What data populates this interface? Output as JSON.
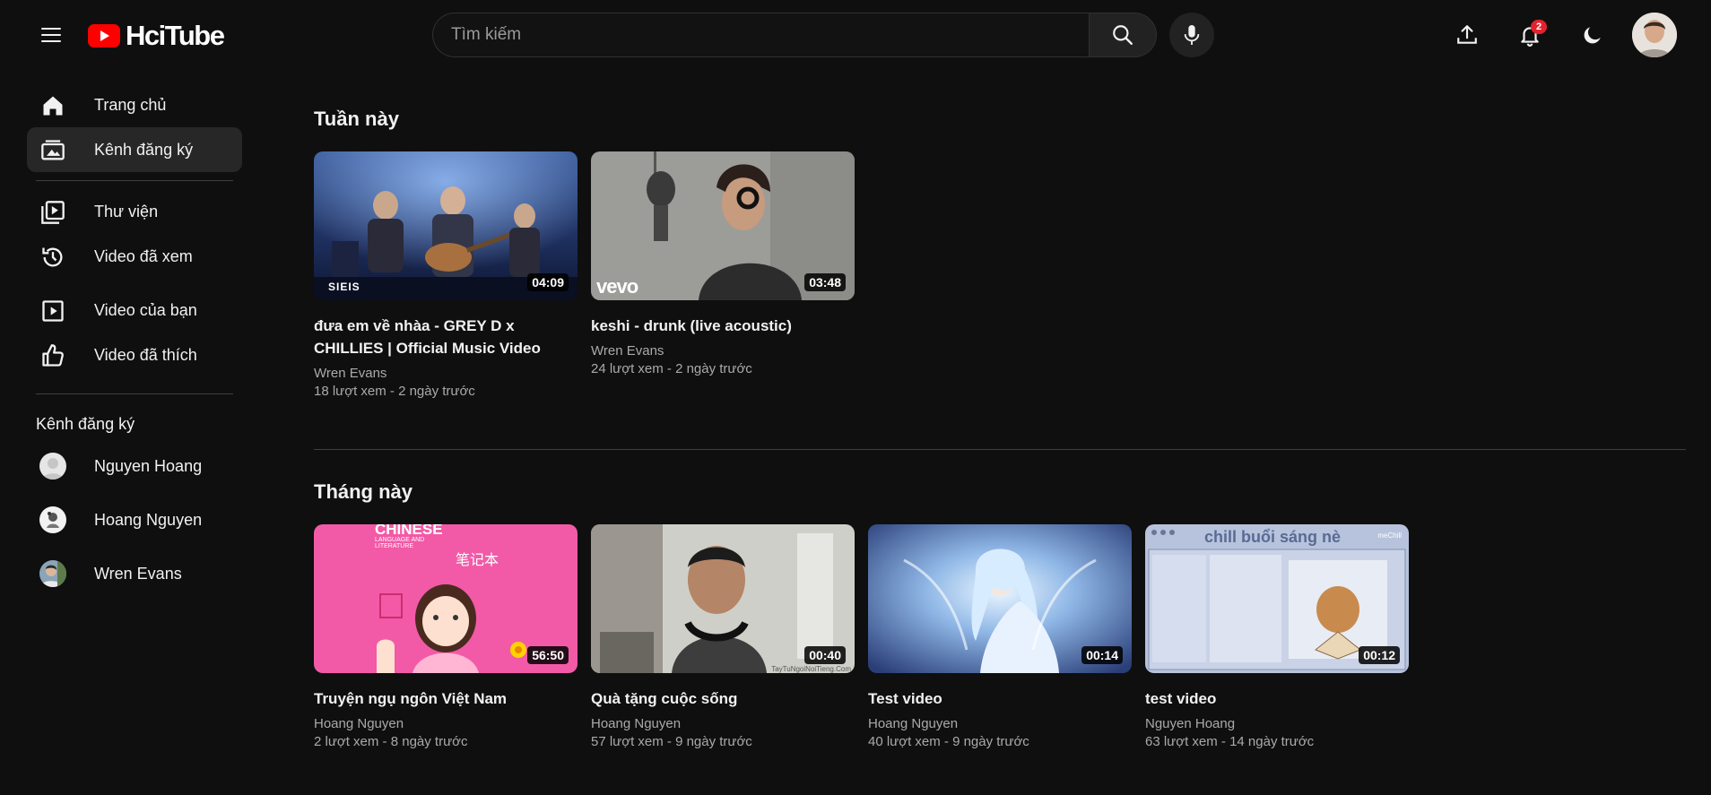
{
  "header": {
    "logo_text": "HciTube",
    "search_placeholder": "Tìm kiếm",
    "notification_count": "2"
  },
  "sidebar": {
    "items": [
      {
        "label": "Trang chủ",
        "icon": "home-icon"
      },
      {
        "label": "Kênh đăng ký",
        "icon": "subscriptions-icon",
        "active": true
      },
      {
        "label": "Thư viện",
        "icon": "library-icon"
      },
      {
        "label": "Video đã xem",
        "icon": "history-icon"
      },
      {
        "label": "Video của bạn",
        "icon": "your-videos-icon"
      },
      {
        "label": "Video đã thích",
        "icon": "like-icon"
      }
    ],
    "subscriptions_heading": "Kênh đăng ký",
    "channels": [
      {
        "name": "Nguyen Hoang"
      },
      {
        "name": "Hoang Nguyen"
      },
      {
        "name": "Wren Evans"
      }
    ]
  },
  "sections": [
    {
      "title": "Tuần này",
      "videos": [
        {
          "title": "đưa em về nhàa - GREY D x CHILLIES | Official Music Video",
          "channel": "Wren Evans",
          "meta": "18 lượt xem - 2 ngày trước",
          "duration": "04:09",
          "thumb_watermark": "SIEIS"
        },
        {
          "title": "keshi - drunk (live acoustic)",
          "channel": "Wren Evans",
          "meta": "24 lượt xem - 2 ngày trước",
          "duration": "03:48",
          "thumb_watermark": "vevo"
        }
      ]
    },
    {
      "title": "Tháng này",
      "videos": [
        {
          "title": "Truyện ngụ ngôn Việt Nam",
          "channel": "Hoang Nguyen",
          "meta": "2 lượt xem - 8 ngày trước",
          "duration": "56:50",
          "thumb_text_1": "CHINESE",
          "thumb_text_2": "LANGUAGE AND LITERATURE",
          "thumb_text_3": "笔记本"
        },
        {
          "title": "Quà tặng cuộc sống",
          "channel": "Hoang Nguyen",
          "meta": "57 lượt xem - 9 ngày trước",
          "duration": "00:40",
          "thumb_watermark": "TayTuNgoiNoiTieng.Com"
        },
        {
          "title": "Test video",
          "channel": "Hoang Nguyen",
          "meta": "40 lượt xem - 9 ngày trước",
          "duration": "00:14"
        },
        {
          "title": "test video",
          "channel": "Nguyen Hoang",
          "meta": "63 lượt xem - 14 ngày trước",
          "duration": "00:12",
          "thumb_text_1": "chill buổi sáng nè",
          "thumb_text_2": "meChill"
        }
      ]
    }
  ]
}
